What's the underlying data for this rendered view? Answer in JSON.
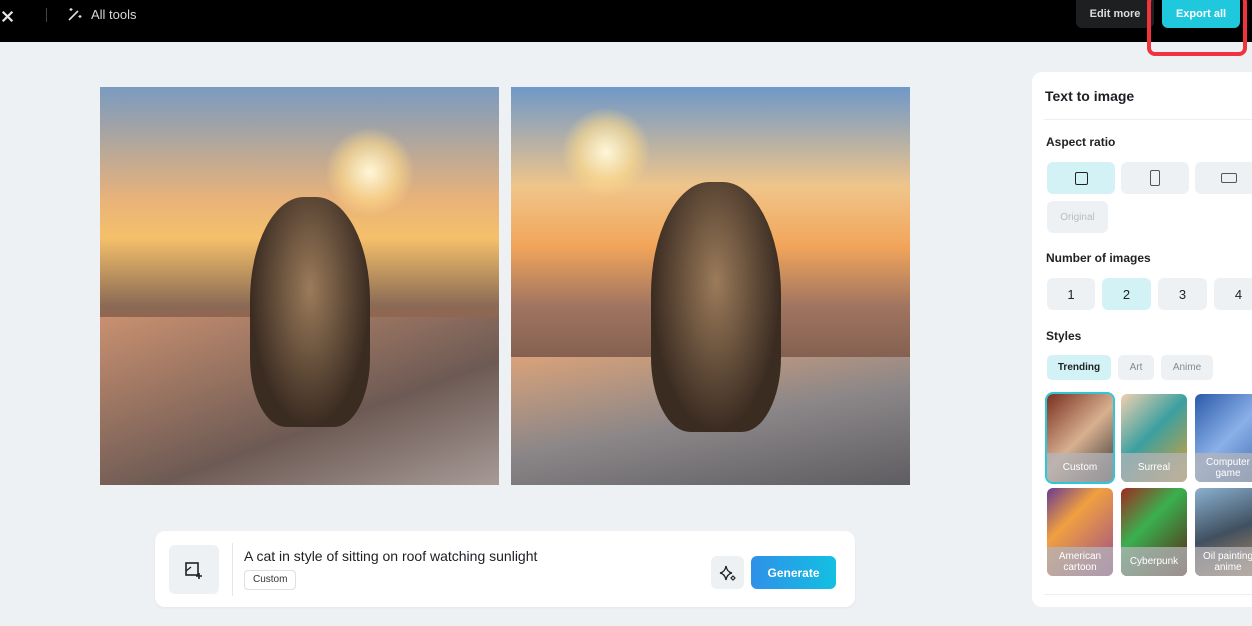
{
  "topbar": {
    "all_tools": "All tools",
    "edit_more": "Edit more",
    "export_all": "Export all"
  },
  "prompt": {
    "text": "A cat in style of sitting on roof watching sunlight",
    "style_tag": "Custom",
    "generate": "Generate"
  },
  "panel": {
    "title": "Text to image",
    "aspect_ratio_label": "Aspect ratio",
    "aspect_ratio_selected": "square",
    "original": "Original",
    "number_label": "Number of images",
    "numbers": [
      "1",
      "2",
      "3",
      "4"
    ],
    "number_selected": "2",
    "styles_label": "Styles",
    "style_tabs": [
      "Trending",
      "Art",
      "Anime"
    ],
    "styles": [
      "Custom",
      "Surreal",
      "Computer game",
      "American cartoon",
      "Cyberpunk",
      "Oil painting anime"
    ],
    "style_selected": "Custom"
  },
  "colors": {
    "accent": "#1fc8dc",
    "highlight": "#f0333f",
    "selected_bg": "#d2f2f6"
  }
}
